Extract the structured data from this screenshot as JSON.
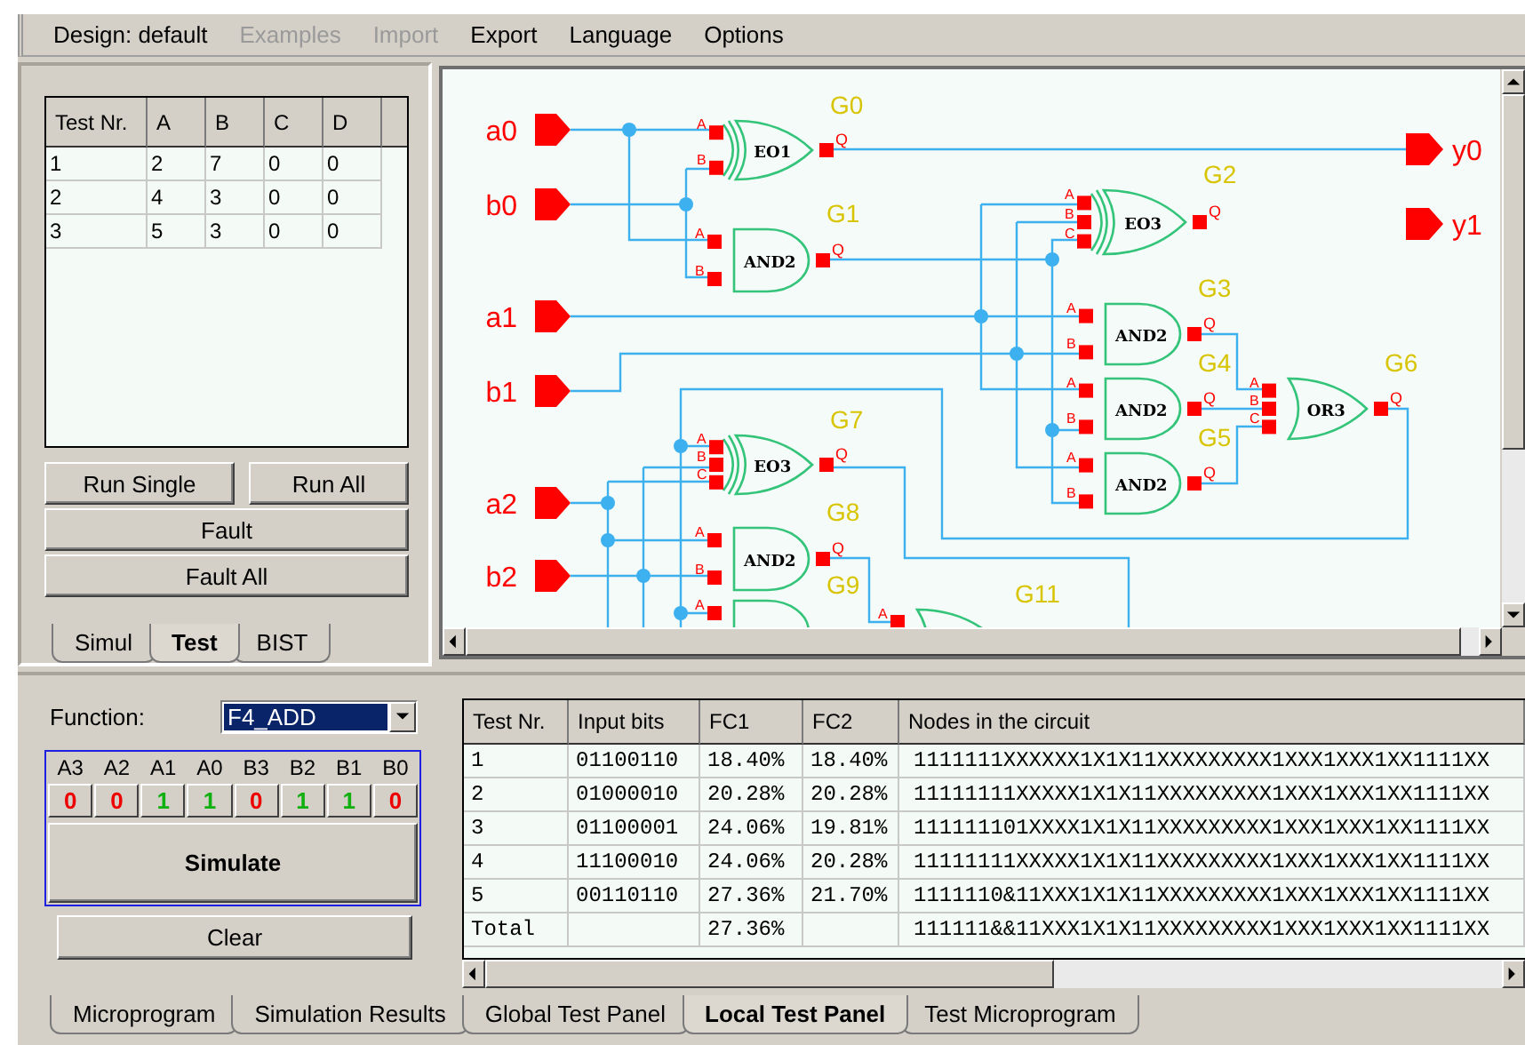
{
  "menu": [
    {
      "label": "Design: default",
      "disabled": false
    },
    {
      "label": "Examples",
      "disabled": true
    },
    {
      "label": "Import",
      "disabled": true
    },
    {
      "label": "Export",
      "disabled": false
    },
    {
      "label": "Language",
      "disabled": false
    },
    {
      "label": "Options",
      "disabled": false
    }
  ],
  "test_table": {
    "columns": [
      "Test Nr.",
      "A",
      "B",
      "C",
      "D"
    ],
    "rows": [
      [
        "1",
        "2",
        "7",
        "0",
        "0"
      ],
      [
        "2",
        "4",
        "3",
        "0",
        "0"
      ],
      [
        "3",
        "5",
        "3",
        "0",
        "0"
      ]
    ]
  },
  "test_buttons": {
    "run_single": "Run Single",
    "run_all": "Run All",
    "fault": "Fault",
    "fault_all": "Fault All"
  },
  "side_tabs": [
    {
      "label": "Simul",
      "selected": false
    },
    {
      "label": "Test",
      "selected": true
    },
    {
      "label": "BIST",
      "selected": false
    }
  ],
  "circuit": {
    "inputs": [
      {
        "label": "a0"
      },
      {
        "label": "b0"
      },
      {
        "label": "a1"
      },
      {
        "label": "b1"
      },
      {
        "label": "a2"
      },
      {
        "label": "b2"
      }
    ],
    "outputs": [
      {
        "label": "y0"
      },
      {
        "label": "y1"
      }
    ],
    "gates": [
      {
        "name": "G0",
        "type": "EO1",
        "kind": "xor",
        "pins": [
          "A",
          "B"
        ],
        "output": "Q"
      },
      {
        "name": "G1",
        "type": "AND2",
        "kind": "and",
        "pins": [
          "A",
          "B"
        ],
        "output": "Q"
      },
      {
        "name": "G7",
        "type": "EO3",
        "kind": "xor",
        "pins": [
          "A",
          "B",
          "C"
        ],
        "output": "Q"
      },
      {
        "name": "G8",
        "type": "AND2",
        "kind": "and",
        "pins": [
          "A",
          "B"
        ],
        "output": "Q"
      },
      {
        "name": "G9",
        "kind": "and",
        "pins": [
          "A"
        ]
      },
      {
        "name": "G11",
        "kind": "or",
        "pins": [
          "A"
        ]
      },
      {
        "name": "G2",
        "type": "EO3",
        "kind": "xor",
        "pins": [
          "A",
          "B",
          "C"
        ],
        "output": "Q"
      },
      {
        "name": "G3",
        "type": "AND2",
        "kind": "and",
        "pins": [
          "A",
          "B"
        ],
        "output": "Q"
      },
      {
        "name": "G4",
        "type": "AND2",
        "kind": "and",
        "pins": [
          "A",
          "B"
        ],
        "output": "Q"
      },
      {
        "name": "G5",
        "type": "AND2",
        "kind": "and",
        "pins": [
          "A",
          "B"
        ],
        "output": "Q"
      },
      {
        "name": "G6",
        "type": "OR3",
        "kind": "or",
        "pins": [
          "A",
          "B",
          "C"
        ],
        "output": "Q"
      }
    ]
  },
  "function": {
    "label": "Function:",
    "value": "F4_ADD"
  },
  "bits": [
    {
      "label": "A3",
      "value": "0",
      "on": false
    },
    {
      "label": "A2",
      "value": "0",
      "on": false
    },
    {
      "label": "A1",
      "value": "1",
      "on": true
    },
    {
      "label": "A0",
      "value": "1",
      "on": true
    },
    {
      "label": "B3",
      "value": "0",
      "on": false
    },
    {
      "label": "B2",
      "value": "1",
      "on": true
    },
    {
      "label": "B1",
      "value": "1",
      "on": true
    },
    {
      "label": "B0",
      "value": "0",
      "on": false
    }
  ],
  "simulate": "Simulate",
  "clear": "Clear",
  "results_table": {
    "columns": [
      "Test Nr.",
      "Input bits",
      "FC1",
      "FC2",
      "Nodes in the circuit"
    ],
    "rows": [
      [
        "1",
        "01100110",
        "18.40%",
        "18.40%",
        "1111111XXXXXX1X1X11XXXXXXXXX1XXX1XXX1XX1111XX"
      ],
      [
        "2",
        "01000010",
        "20.28%",
        "20.28%",
        "11111111XXXXX1X1X11XXXXXXXXX1XXX1XXX1XX1111XX"
      ],
      [
        "3",
        "01100001",
        "24.06%",
        "19.81%",
        "111111101XXXX1X1X11XXXXXXXXX1XXX1XXX1XX1111XX"
      ],
      [
        "4",
        "11100010",
        "24.06%",
        "20.28%",
        "11111111XXXXX1X1X11XXXXXXXXX1XXX1XXX1XX1111XX"
      ],
      [
        "5",
        "00110110",
        "27.36%",
        "21.70%",
        "1111110&11XXX1X1X11XXXXXXXXX1XXX1XXX1XX1111XX"
      ],
      [
        "Total",
        null,
        "27.36%",
        null,
        "111111&&11XXX1X1X11XXXXXXXXX1XXX1XXX1XX1111XX"
      ]
    ]
  },
  "bottom_tabs": [
    {
      "label": "Microprogram",
      "selected": false
    },
    {
      "label": "Simulation Results",
      "selected": false
    },
    {
      "label": "Global Test Panel",
      "selected": false
    },
    {
      "label": "Local Test Panel",
      "selected": true
    },
    {
      "label": "Test Microprogram",
      "selected": false
    }
  ]
}
